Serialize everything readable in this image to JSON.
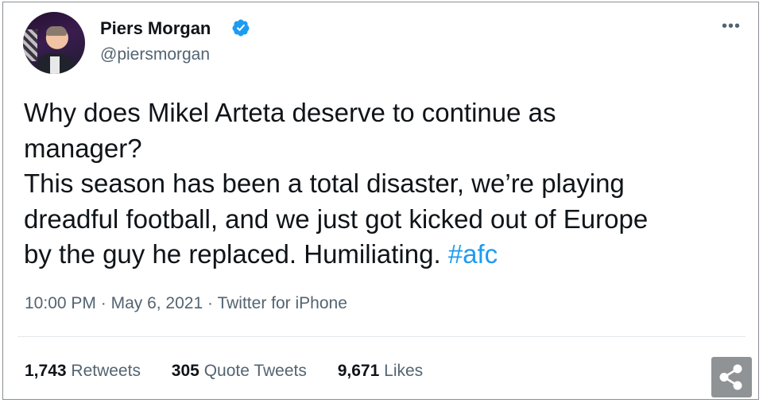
{
  "author": {
    "display_name": "Piers Morgan",
    "handle": "@piersmorgan",
    "verified_icon": "verified-badge-icon",
    "avatar_icon": "profile-photo"
  },
  "more_menu": {
    "label": "•••",
    "icon": "more-options-icon"
  },
  "tweet": {
    "lines": [
      "Why does Mikel Arteta deserve to continue as",
      "manager?",
      "This season has been a total disaster, we’re playing",
      "dreadful football, and we just got kicked out of Europe",
      "by the guy he replaced. Humiliating."
    ],
    "hashtag": "#afc"
  },
  "meta": {
    "time": "10:00 PM",
    "dot1": "·",
    "date": "May 6, 2021",
    "dot2": "·",
    "source": "Twitter for iPhone"
  },
  "stats": {
    "retweets_count": "1,743",
    "retweets_label": "Retweets",
    "quotes_count": "305",
    "quotes_label": "Quote Tweets",
    "likes_count": "9,671",
    "likes_label": "Likes"
  },
  "share": {
    "icon": "share-icon"
  },
  "colors": {
    "accent": "#1d9bf0",
    "text": "#0f1419",
    "secondary": "#536471",
    "share_bg": "#8f9396"
  }
}
